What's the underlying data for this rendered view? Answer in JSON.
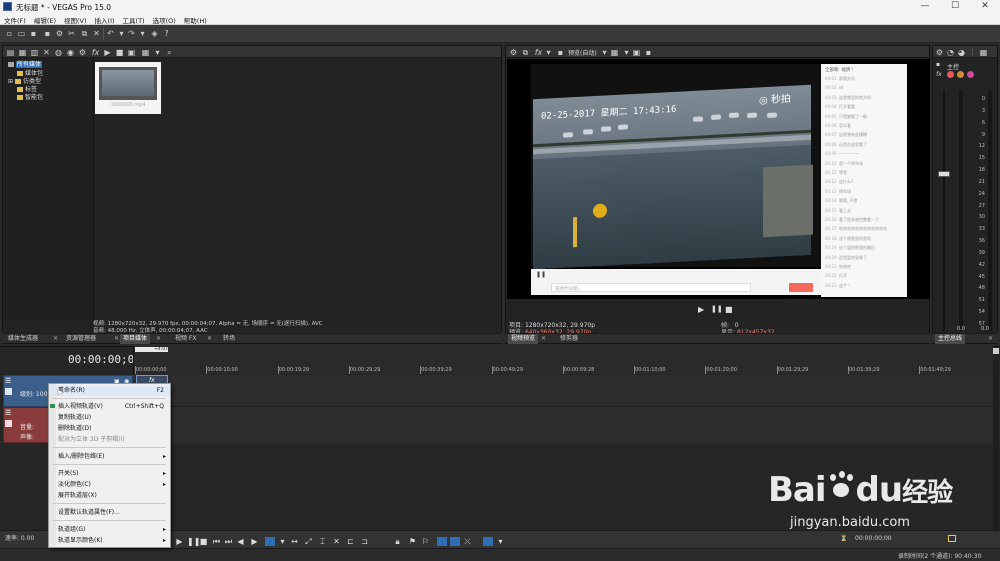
{
  "window": {
    "title": "无标题 * - VEGAS Pro 15.0",
    "controls": [
      "minimize-icon",
      "maximize-icon",
      "close-icon"
    ]
  },
  "menubar": [
    "文件(F)",
    "编辑(E)",
    "视图(V)",
    "插入(I)",
    "工具(T)",
    "选项(O)",
    "帮助(H)"
  ],
  "explorer": {
    "tree": [
      "所有媒体",
      "媒体包",
      "仿类型",
      "标签",
      "智能包"
    ],
    "thumb_label": "1000000.mp4",
    "info_line1": "视频: 1280x720x32, 29.970 fps, 00:00:04;07, Alpha = 无, 场顺序 = 无(逐行扫描), AVC",
    "info_line2": "音频: 48,000 Hz, 立体声, 00:00:04;07, AAC",
    "tabs": [
      "媒体生成器",
      "资源管理器",
      "项目媒体",
      "视频 FX",
      "转场"
    ]
  },
  "preview": {
    "toolbar_label": "预览(自动)",
    "info": {
      "project_label": "项目:",
      "project_val": "1280x720x32, 29.970p",
      "preview_label": "预览:",
      "preview_val": "640x360x32, 29.970p",
      "frame_label": "帧:",
      "frame_val": "0",
      "display_label": "显示:",
      "display_val": "812x457x32"
    },
    "tabs": [
      "视频预览",
      "修剪器"
    ],
    "overlay": {
      "timestamp": "02-25-2017 星期二 17:43:16",
      "logo": "秒拍"
    },
    "chat_header": [
      "全部聊",
      "福牌 !"
    ],
    "chat_lines": [
      [
        "00:01",
        "那我先问"
      ],
      [
        "00:02",
        "ok"
      ],
      [
        "00:03",
        "这是哪里的地方呀"
      ],
      [
        "00:04",
        "打开看看"
      ],
      [
        "00:05",
        "只是翻看了一眼"
      ],
      [
        "00:06",
        "怎么看"
      ],
      [
        "00:07",
        "这视频有些模糊"
      ],
      [
        "00:08",
        "还是在这里看了"
      ],
      [
        "00:09",
        "—————"
      ],
      [
        "00:10",
        "是一个停车场"
      ],
      [
        "00:11",
        "等等"
      ],
      [
        "00:12",
        "这什么?"
      ],
      [
        "00:13",
        "停车场"
      ],
      [
        "00:14",
        "嗯嗯, 不错"
      ],
      [
        "00:15",
        "看上去"
      ],
      [
        "00:16",
        "看了很多遍完整看一下"
      ],
      [
        "00:17",
        "哈哈哈哈哈哈哈哈哈哈哈哈"
      ],
      [
        "00:18",
        "这个视频里的是啥"
      ],
      [
        "00:19",
        "这个监控视频的最后"
      ],
      [
        "00:20",
        "这是监控录像了"
      ],
      [
        "00:21",
        "哈哈哈"
      ],
      [
        "00:22",
        "打开"
      ],
      [
        "00:23",
        "这个 !"
      ]
    ],
    "chat_input_placeholder": "说点什么吧..."
  },
  "mixer": {
    "title": "主控",
    "scale": [
      "0",
      "3",
      "6",
      "9",
      "12",
      "15",
      "18",
      "21",
      "24",
      "27",
      "30",
      "33",
      "36",
      "39",
      "42",
      "45",
      "48",
      "51",
      "54",
      "57"
    ],
    "level_left": "0.0",
    "level_right": "0.0",
    "tab": "主控总线"
  },
  "timeline": {
    "timecode": "00:00:00;00",
    "marker": "+4:07",
    "ruler": [
      "00:00:00;00",
      "00:00:10;00",
      "00:00:19;29",
      "00:00:29;29",
      "00:00:39;29",
      "00:00:49;29",
      "00:00:59;28",
      "00:01:10;00",
      "00:01:20;00",
      "00:01:29;29",
      "00:01:39;29",
      "00:01:49;29"
    ],
    "video_track": {
      "label": "级别: 100.0 %"
    },
    "audio_track": {
      "volume_label": "音量:",
      "pan_label": "声像:"
    },
    "rate_label": "速率: 0.00",
    "record_time": "录制时间(2 个通道): 90:40:30",
    "end_timecode": "00:00:00;00"
  },
  "context_menu": {
    "items": [
      {
        "label": "重命名(R)",
        "shortcut": "F2",
        "submenu": false,
        "disabled": false
      },
      {
        "label": "插入视频轨道(V)",
        "shortcut": "Ctrl+Shift+Q",
        "submenu": false,
        "disabled": false
      },
      {
        "label": "复制轨道(U)",
        "shortcut": "",
        "submenu": false,
        "disabled": false
      },
      {
        "label": "删除轨道(D)",
        "shortcut": "",
        "submenu": false,
        "disabled": false
      },
      {
        "label": "配对为立体 3D 子剪辑(I)",
        "shortcut": "",
        "submenu": false,
        "disabled": true
      },
      {
        "label": "插入/删除包络(E)",
        "shortcut": "",
        "submenu": true,
        "disabled": false
      },
      {
        "label": "开关(S)",
        "shortcut": "",
        "submenu": true,
        "disabled": false
      },
      {
        "label": "淡化颜色(C)",
        "shortcut": "",
        "submenu": true,
        "disabled": false
      },
      {
        "label": "展开轨道层(X)",
        "shortcut": "",
        "submenu": false,
        "disabled": false
      },
      {
        "label": "设置默认轨道属性(F)...",
        "shortcut": "",
        "submenu": false,
        "disabled": false
      },
      {
        "label": "轨道组(G)",
        "shortcut": "",
        "submenu": true,
        "disabled": false
      },
      {
        "label": "轨道显示颜色(K)",
        "shortcut": "",
        "submenu": true,
        "disabled": false
      }
    ]
  },
  "watermark": {
    "brand": "Bai",
    "brand2": "du",
    "brand_cn": "经验",
    "url": "jingyan.baidu.com"
  },
  "colors": {
    "accent": "#2f6db5",
    "video_track": "#3b5f8a",
    "audio_track": "#8a3b3b",
    "meter_highlight": "#ff4a4a"
  }
}
